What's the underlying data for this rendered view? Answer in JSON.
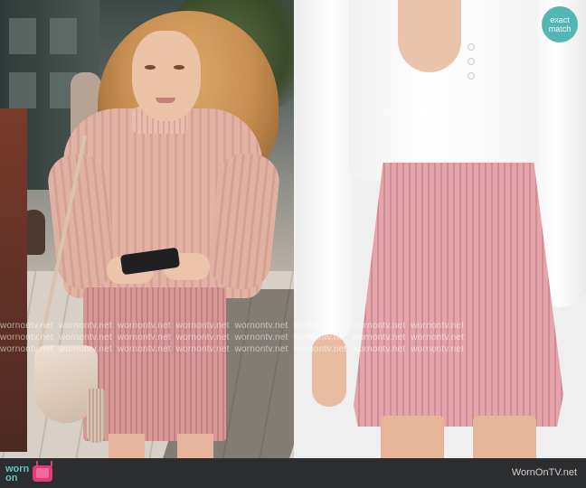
{
  "badge": {
    "line1": "exact",
    "line2": "match",
    "color": "#52b6b4"
  },
  "watermark": {
    "text": "wornontv.net"
  },
  "footer": {
    "logo_line1": "worn",
    "logo_line2": "on",
    "logo_icon": "tv-icon",
    "site": "WornOnTV.net",
    "background": "#2c2d2f",
    "accent": "#63c3c1"
  }
}
